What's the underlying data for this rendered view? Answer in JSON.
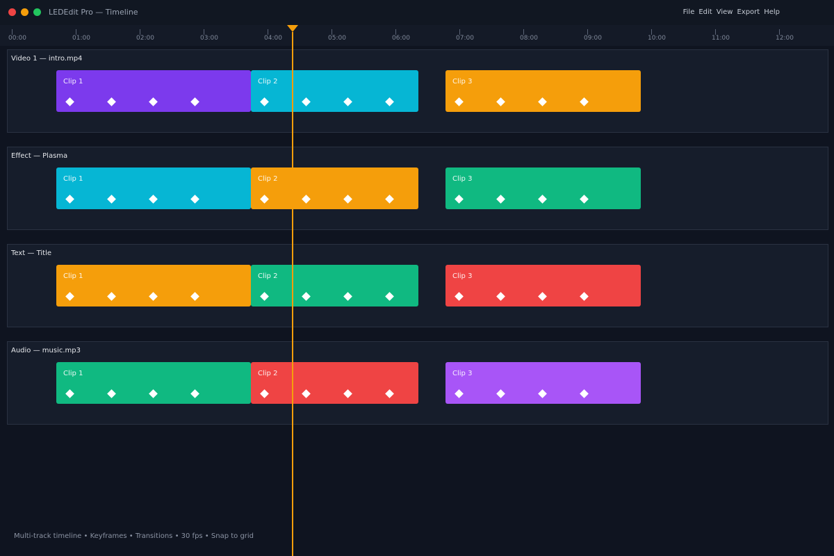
{
  "window": {
    "title": "LEDEdit Pro — Timeline",
    "menu": [
      "File",
      "Edit",
      "View",
      "Export",
      "Help"
    ]
  },
  "ruler": {
    "labels": [
      "00:00",
      "01:00",
      "02:00",
      "03:00",
      "04:00",
      "05:00",
      "06:00",
      "07:00",
      "08:00",
      "09:00",
      "10:00",
      "11:00",
      "12:00"
    ]
  },
  "playhead": {
    "color": "#f59e0b"
  },
  "tracks": [
    {
      "label": "Video 1 — intro.mp4",
      "clips": [
        {
          "label": "Clip 1",
          "color": "#7c3aed"
        },
        {
          "label": "Clip 2",
          "color": "#06b6d4"
        },
        {
          "label": "Clip 3",
          "color": "#f59e0b"
        }
      ]
    },
    {
      "label": "Effect — Plasma",
      "clips": [
        {
          "label": "Clip 1",
          "color": "#06b6d4"
        },
        {
          "label": "Clip 2",
          "color": "#f59e0b"
        },
        {
          "label": "Clip 3",
          "color": "#10b981"
        }
      ]
    },
    {
      "label": "Text — Title",
      "clips": [
        {
          "label": "Clip 1",
          "color": "#f59e0b"
        },
        {
          "label": "Clip 2",
          "color": "#10b981"
        },
        {
          "label": "Clip 3",
          "color": "#ef4444"
        }
      ]
    },
    {
      "label": "Audio — music.mp3",
      "clips": [
        {
          "label": "Clip 1",
          "color": "#10b981"
        },
        {
          "label": "Clip 2",
          "color": "#ef4444"
        },
        {
          "label": "Clip 3",
          "color": "#a855f7"
        }
      ]
    }
  ],
  "status": "Multi-track timeline • Keyframes • Transitions • 30 fps • Snap to grid"
}
